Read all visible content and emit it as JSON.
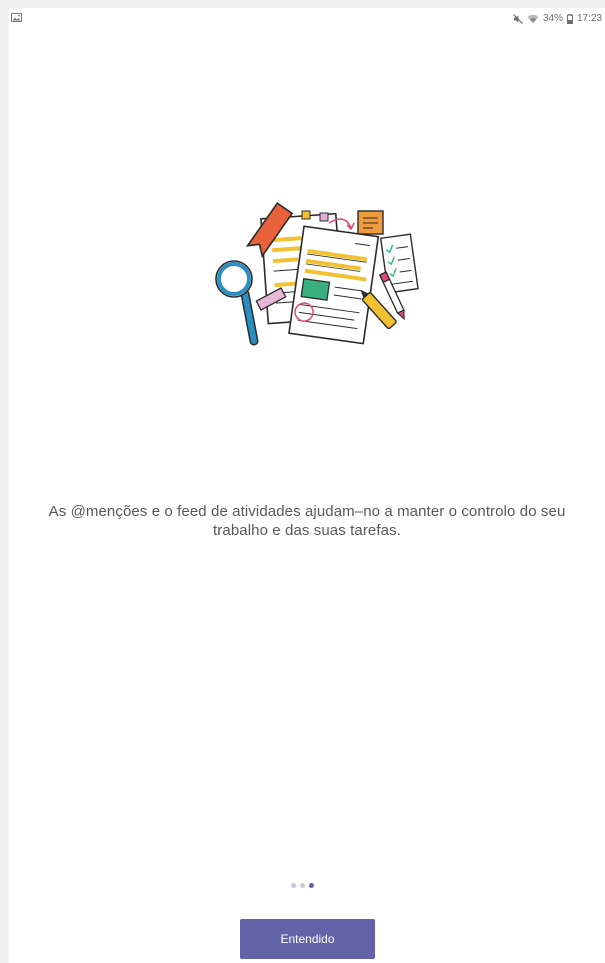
{
  "status_bar": {
    "battery": "34%",
    "time": "17:23",
    "icons": [
      "image-notification-icon",
      "mute-icon",
      "wifi-icon",
      "battery-icon"
    ]
  },
  "onboarding": {
    "illustration": "documents-review-illustration",
    "message": "As @menções e o feed de atividades ajudam–no a manter o controlo do seu trabalho e das suas tarefas.",
    "pager": {
      "total": 3,
      "active": 3
    },
    "button_label": "Entendido"
  },
  "colors": {
    "accent": "#6264a7",
    "text": "#585858",
    "dot_inactive": "#c9c9de"
  }
}
